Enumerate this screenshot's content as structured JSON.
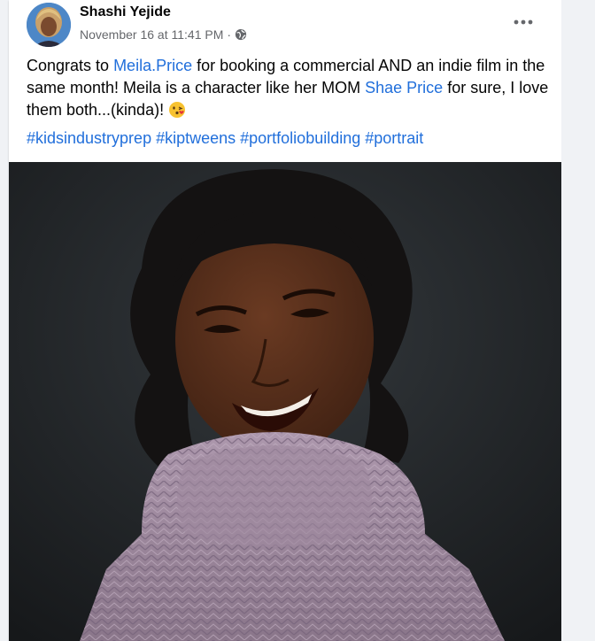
{
  "post": {
    "author": "Shashi Yejide",
    "timestamp": "November 16 at 11:41 PM",
    "separator": "·",
    "privacy_icon": "globe-icon",
    "more_icon": "more-options-icon",
    "text": {
      "part1": "Congrats to ",
      "mention1": "Meila.Price",
      "part2": " for booking a commercial AND an indie film in the same month! Meila is a character like her MOM ",
      "mention2": "Shae Price",
      "part3": " for sure, I love them both...(kinda)! ",
      "emoji": "kissing-face-emoji"
    },
    "hashtags": [
      "#kidsindustryprep",
      "#kiptweens",
      "#portfoliobuilding",
      "#portrait"
    ],
    "photo_icon": "portrait-photo"
  },
  "colors": {
    "link": "#216fdb",
    "muted": "#65676b",
    "photo_background": "#1e2022",
    "sweater": "#a08ca0"
  }
}
